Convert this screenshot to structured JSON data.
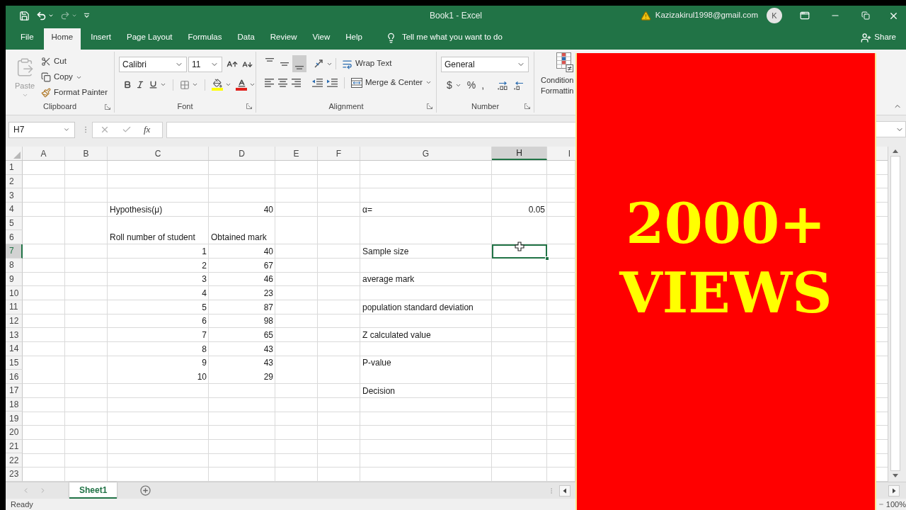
{
  "title_bar": {
    "title": "Book1 - Excel",
    "account": "Kazizakirul1998@gmail.com",
    "avatar_initial": "K"
  },
  "menu_tabs": [
    {
      "label": "File",
      "selected": false
    },
    {
      "label": "Home",
      "selected": true
    },
    {
      "label": "Insert",
      "selected": false
    },
    {
      "label": "Page Layout",
      "selected": false
    },
    {
      "label": "Formulas",
      "selected": false
    },
    {
      "label": "Data",
      "selected": false
    },
    {
      "label": "Review",
      "selected": false
    },
    {
      "label": "View",
      "selected": false
    },
    {
      "label": "Help",
      "selected": false
    }
  ],
  "tell_me": "Tell me what you want to do",
  "share": "Share",
  "ribbon": {
    "clipboard": {
      "label": "Clipboard",
      "paste": {
        "label": "Paste",
        "disabled": true
      },
      "commands": [
        {
          "kind": "cut",
          "label": "Cut"
        },
        {
          "kind": "copy",
          "label": "Copy"
        },
        {
          "kind": "format_painter",
          "label": "Format Painter"
        }
      ]
    },
    "font": {
      "label": "Font",
      "font_name": "Calibri",
      "font_size": "11"
    },
    "alignment": {
      "label": "Alignment",
      "vertical": [
        {
          "kind": "top",
          "selected": false
        },
        {
          "kind": "middle",
          "selected": false
        },
        {
          "kind": "bottom",
          "selected": true
        }
      ],
      "wrap_text": "Wrap Text",
      "merge": "Merge & Center"
    },
    "number": {
      "label": "Number",
      "format": "General",
      "symbols": [
        {
          "kind": "currency",
          "label": "$"
        },
        {
          "kind": "percent",
          "label": "%"
        },
        {
          "kind": "comma",
          "label": ","
        }
      ]
    },
    "styles": {
      "conditional_formatting": [
        "Condition",
        "Formattin"
      ]
    }
  },
  "formula_bar": {
    "name_box": "H7",
    "function_label": "fx"
  },
  "columns": [
    {
      "label": "A",
      "selected": false
    },
    {
      "label": "B",
      "selected": false
    },
    {
      "label": "C",
      "selected": false
    },
    {
      "label": "D",
      "selected": false
    },
    {
      "label": "E",
      "selected": false
    },
    {
      "label": "F",
      "selected": false
    },
    {
      "label": "G",
      "selected": false
    },
    {
      "label": "H",
      "selected": true
    },
    {
      "label": "I",
      "selected": false
    }
  ],
  "rows": [
    {
      "label": "1",
      "selected": false
    },
    {
      "label": "2",
      "selected": false
    },
    {
      "label": "3",
      "selected": false
    },
    {
      "label": "4",
      "selected": false,
      "cells": {
        "C": {
          "kind": "text",
          "text": "Hypothesis(μ)"
        },
        "D": {
          "kind": "number",
          "text": "40"
        },
        "G": {
          "kind": "text",
          "text": "α="
        },
        "H": {
          "kind": "number",
          "text": "0.05"
        }
      }
    },
    {
      "label": "5",
      "selected": false
    },
    {
      "label": "6",
      "selected": false,
      "cells": {
        "C": {
          "kind": "text",
          "text": "Roll number of student"
        },
        "D": {
          "kind": "text",
          "text": "Obtained mark"
        }
      }
    },
    {
      "label": "7",
      "selected": true,
      "cells": {
        "C": {
          "kind": "number",
          "text": "1"
        },
        "D": {
          "kind": "number",
          "text": "40"
        },
        "G": {
          "kind": "text",
          "text": "Sample size"
        }
      }
    },
    {
      "label": "8",
      "selected": false,
      "cells": {
        "C": {
          "kind": "number",
          "text": "2"
        },
        "D": {
          "kind": "number",
          "text": "67"
        }
      }
    },
    {
      "label": "9",
      "selected": false,
      "cells": {
        "C": {
          "kind": "number",
          "text": "3"
        },
        "D": {
          "kind": "number",
          "text": "46"
        },
        "G": {
          "kind": "text",
          "text": "average mark"
        }
      }
    },
    {
      "label": "10",
      "selected": false,
      "cells": {
        "C": {
          "kind": "number",
          "text": "4"
        },
        "D": {
          "kind": "number",
          "text": "23"
        }
      }
    },
    {
      "label": "11",
      "selected": false,
      "cells": {
        "C": {
          "kind": "number",
          "text": "5"
        },
        "D": {
          "kind": "number",
          "text": "87"
        },
        "G": {
          "kind": "text",
          "text": "population standard deviation"
        }
      }
    },
    {
      "label": "12",
      "selected": false,
      "cells": {
        "C": {
          "kind": "number",
          "text": "6"
        },
        "D": {
          "kind": "number",
          "text": "98"
        }
      }
    },
    {
      "label": "13",
      "selected": false,
      "cells": {
        "C": {
          "kind": "number",
          "text": "7"
        },
        "D": {
          "kind": "number",
          "text": "65"
        },
        "G": {
          "kind": "text",
          "text": "Z calculated value"
        }
      }
    },
    {
      "label": "14",
      "selected": false,
      "cells": {
        "C": {
          "kind": "number",
          "text": "8"
        },
        "D": {
          "kind": "number",
          "text": "43"
        }
      }
    },
    {
      "label": "15",
      "selected": false,
      "cells": {
        "C": {
          "kind": "number",
          "text": "9"
        },
        "D": {
          "kind": "number",
          "text": "43"
        },
        "G": {
          "kind": "text",
          "text": "P-value"
        }
      }
    },
    {
      "label": "16",
      "selected": false,
      "cells": {
        "C": {
          "kind": "number",
          "text": "10"
        },
        "D": {
          "kind": "number",
          "text": "29"
        }
      }
    },
    {
      "label": "17",
      "selected": false,
      "cells": {
        "G": {
          "kind": "text",
          "text": "Decision"
        }
      }
    },
    {
      "label": "18",
      "selected": false
    },
    {
      "label": "19",
      "selected": false
    },
    {
      "label": "20",
      "selected": false
    },
    {
      "label": "21",
      "selected": false
    },
    {
      "label": "22",
      "selected": false
    },
    {
      "label": "23",
      "selected": false
    }
  ],
  "sheet_tabs": [
    {
      "label": "Sheet1",
      "selected": true
    }
  ],
  "status_bar": {
    "status": "Ready",
    "zoom": "100%"
  },
  "banner": {
    "lines": [
      "2000+",
      "VIEWS"
    ]
  }
}
